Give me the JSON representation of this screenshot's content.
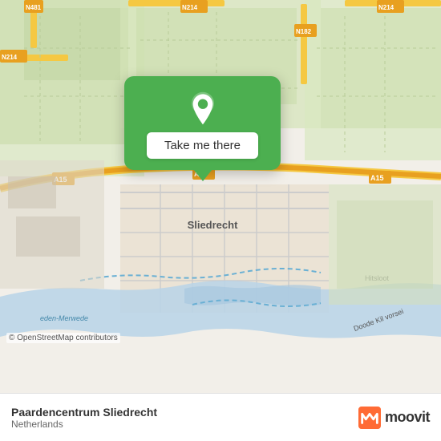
{
  "map": {
    "alt": "Map of Sliedrecht, Netherlands"
  },
  "popup": {
    "button_label": "Take me there"
  },
  "bottom_bar": {
    "location_name": "Paardencentrum Sliedrecht",
    "location_country": "Netherlands",
    "osm_credit": "© OpenStreetMap contributors",
    "moovit_label": "moovit"
  },
  "icons": {
    "pin": "location-pin-icon",
    "moovit_m": "moovit-logo-icon"
  }
}
